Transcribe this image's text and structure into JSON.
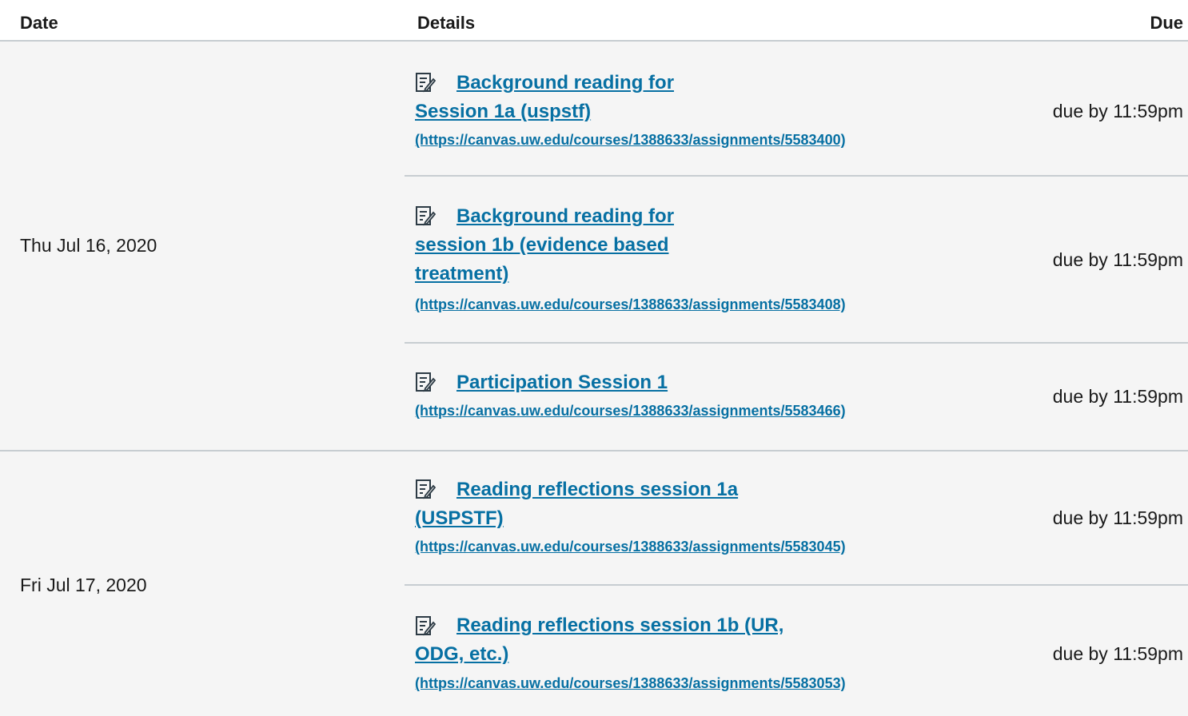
{
  "header": {
    "date": "Date",
    "details": "Details",
    "due": "Due"
  },
  "groups": [
    {
      "date": "Thu Jul 16, 2020",
      "items": [
        {
          "icon": "assignment-icon",
          "title": "Background reading for Session 1a (uspstf)",
          "url": "(https://canvas.uw.edu/courses/1388633/assignments/5583400)",
          "due": "due by 11:59pm"
        },
        {
          "icon": "assignment-icon",
          "title": "Background reading for session 1b (evidence based treatment)",
          "url": "(https://canvas.uw.edu/courses/1388633/assignments/5583408)",
          "due": "due by 11:59pm"
        },
        {
          "icon": "assignment-icon",
          "title": "Participation Session 1",
          "url": "(https://canvas.uw.edu/courses/1388633/assignments/5583466)",
          "due": "due by 11:59pm"
        }
      ]
    },
    {
      "date": "Fri Jul 17, 2020",
      "items": [
        {
          "icon": "assignment-icon",
          "title": "Reading reflections session 1a (USPSTF)",
          "url": "(https://canvas.uw.edu/courses/1388633/assignments/5583045)",
          "due": "due by 11:59pm"
        },
        {
          "icon": "assignment-icon",
          "title": "Reading reflections session 1b (UR, ODG, etc.)",
          "url": "(https://canvas.uw.edu/courses/1388633/assignments/5583053)",
          "due": "due by 11:59pm"
        }
      ]
    }
  ],
  "colors": {
    "link": "#0770a3",
    "row_bg": "#f5f5f5",
    "divider": "#c7cdd1",
    "text": "#1a1a1a"
  }
}
